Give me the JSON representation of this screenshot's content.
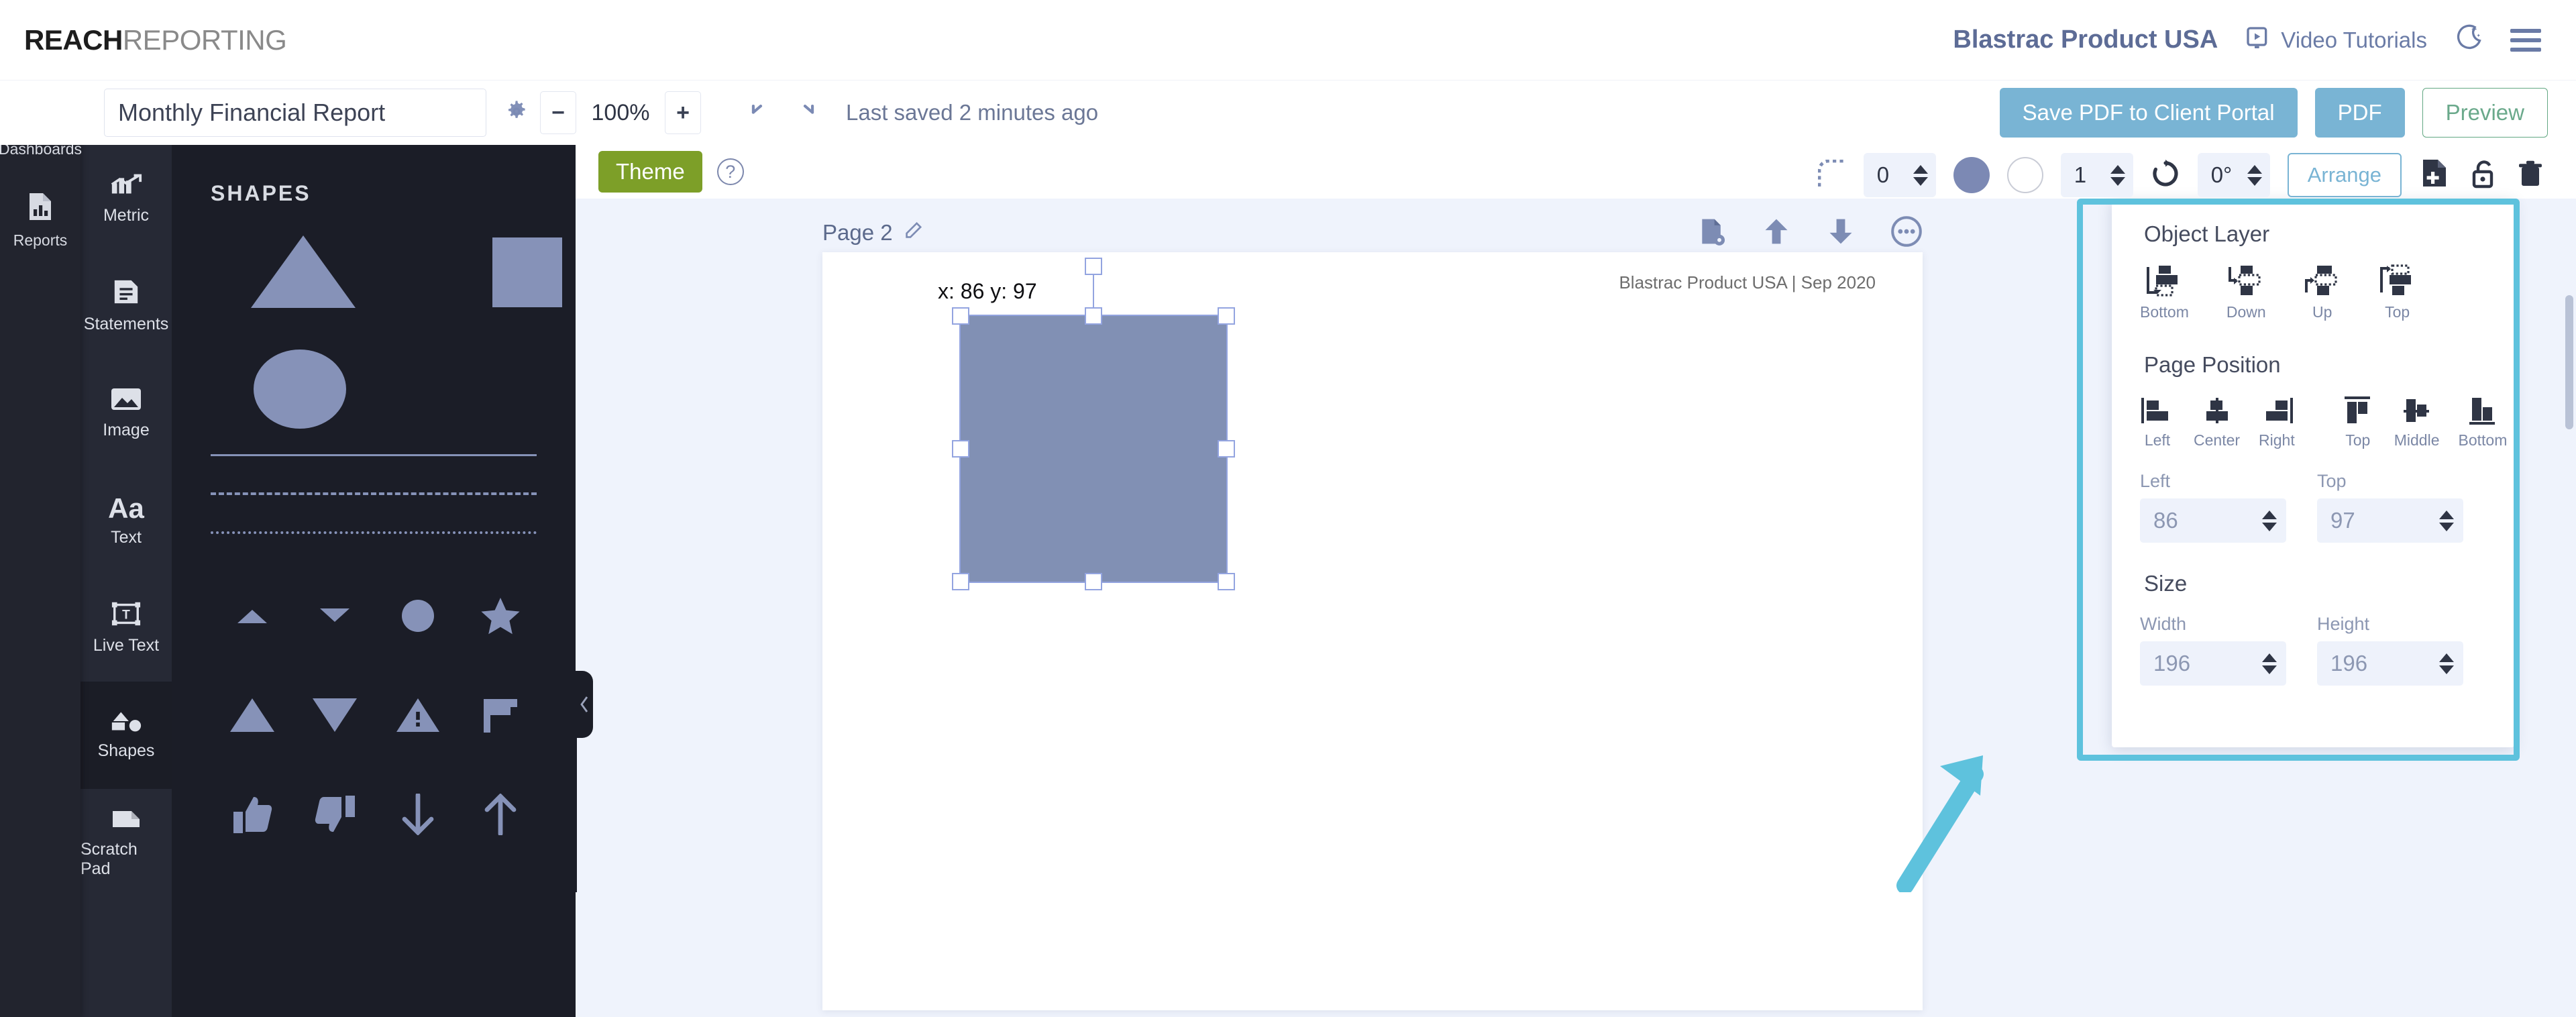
{
  "header": {
    "logo_bold": "REACH",
    "logo_light": "REPORTING",
    "company_name": "Blastrac Product USA",
    "video_tutorials_label": "Video Tutorials",
    "video_tutorials_icon": "video-play-icon",
    "dark_mode_icon": "moon-star-icon",
    "menu_icon": "hamburger-menu-icon",
    "accent_color": "#6a7ba6"
  },
  "toolbar": {
    "report_title": "Monthly Financial Report",
    "report_title_placeholder": "Report name",
    "settings_icon": "gear-icon",
    "zoom_out_label": "−",
    "zoom_level": "100%",
    "zoom_in_label": "+",
    "undo_icon": "undo-arrow-icon",
    "redo_icon": "redo-arrow-icon",
    "save_status": "Last saved 2 minutes ago",
    "save_pdf_label": "Save PDF to Client Portal",
    "pdf_label": "PDF",
    "preview_label": "Preview",
    "primary_color": "#79b4d4",
    "preview_color": "#63a883"
  },
  "rail": {
    "items": [
      {
        "label": "Dashboards",
        "icon": "dashboard-monitor-icon"
      },
      {
        "label": "Reports",
        "icon": "report-chart-file-icon"
      }
    ]
  },
  "tools": {
    "items": [
      {
        "label": "Metric",
        "icon": "metric-bars-icon",
        "active": false
      },
      {
        "label": "Statements",
        "icon": "statement-document-icon",
        "active": false
      },
      {
        "label": "Image",
        "icon": "image-picture-icon",
        "active": false
      },
      {
        "label": "Text",
        "icon": "text-aa-icon",
        "active": false
      },
      {
        "label": "Live Text",
        "icon": "live-text-box-icon",
        "active": false
      },
      {
        "label": "Shapes",
        "icon": "shapes-icon",
        "active": true
      },
      {
        "label": "Scratch Pad",
        "icon": "scratch-pad-icon",
        "active": false
      }
    ]
  },
  "shapes_panel": {
    "title": "SHAPES",
    "shape_color": "#8692b8",
    "primary_shapes": [
      {
        "name": "triangle-large",
        "icon": "triangle-icon"
      },
      {
        "name": "square-large",
        "icon": "square-icon"
      },
      {
        "name": "circle-large",
        "icon": "circle-icon"
      }
    ],
    "lines": [
      {
        "name": "solid-line",
        "style": "solid"
      },
      {
        "name": "dashed-line",
        "style": "dashed"
      },
      {
        "name": "dotted-line",
        "style": "dotted"
      }
    ],
    "icon_shapes": [
      {
        "name": "caret-up",
        "icon": "caret-up-icon"
      },
      {
        "name": "caret-down",
        "icon": "caret-down-icon"
      },
      {
        "name": "circle-small",
        "icon": "circle-filled-icon"
      },
      {
        "name": "star",
        "icon": "star-icon"
      },
      {
        "name": "triangle-up",
        "icon": "triangle-up-icon"
      },
      {
        "name": "triangle-down",
        "icon": "triangle-down-icon"
      },
      {
        "name": "warning-triangle",
        "icon": "warning-triangle-icon"
      },
      {
        "name": "flag",
        "icon": "flag-icon"
      },
      {
        "name": "thumbs-up",
        "icon": "thumbs-up-icon"
      },
      {
        "name": "thumbs-down",
        "icon": "thumbs-down-icon"
      },
      {
        "name": "arrow-down",
        "icon": "arrow-down-icon"
      },
      {
        "name": "arrow-up",
        "icon": "arrow-up-icon"
      }
    ],
    "collapse_icon": "chevron-left-icon"
  },
  "canvas": {
    "theme_label": "Theme",
    "theme_color": "#7d9f28",
    "help_icon": "question-mark-icon",
    "page_label": "Page 2",
    "page_edit_icon": "pencil-edit-icon",
    "page_icons": [
      {
        "name": "page-settings",
        "icon": "file-gear-icon"
      },
      {
        "name": "move-page-up",
        "icon": "arrow-up-icon"
      },
      {
        "name": "move-page-down",
        "icon": "arrow-down-icon"
      },
      {
        "name": "page-more-options",
        "icon": "ellipsis-circle-icon"
      }
    ],
    "page_header_text": "Blastrac Product USA |  Sep 2020",
    "selected_shape": {
      "coord_label": "x: 86 y: 97",
      "fill_color": "#8190b4",
      "selection_color": "#93a4e0"
    }
  },
  "object_toolbar": {
    "border_radius_icon": "corner-radius-icon",
    "border_radius_value": "0",
    "fill_swatch_color": "#7c89b4",
    "stroke_swatch_color": "#ffffff",
    "stroke_width_value": "1",
    "rotate_icon": "rotate-icon",
    "rotation_value": "0°",
    "arrange_label": "Arrange",
    "duplicate_icon": "duplicate-file-icon",
    "lock_icon": "unlock-padlock-icon",
    "delete_icon": "trash-can-icon"
  },
  "arrange_popup": {
    "object_layer": {
      "title": "Object Layer",
      "items": [
        {
          "label": "Bottom",
          "icon": "layer-send-to-back-icon"
        },
        {
          "label": "Down",
          "icon": "layer-send-backward-icon"
        },
        {
          "label": "Up",
          "icon": "layer-bring-forward-icon"
        },
        {
          "label": "Top",
          "icon": "layer-bring-to-front-icon"
        }
      ]
    },
    "page_position": {
      "title": "Page Position",
      "items": [
        {
          "label": "Left",
          "icon": "align-left-icon"
        },
        {
          "label": "Center",
          "icon": "align-center-icon"
        },
        {
          "label": "Right",
          "icon": "align-right-icon"
        },
        {
          "label": "Top",
          "icon": "align-top-icon"
        },
        {
          "label": "Middle",
          "icon": "align-middle-icon"
        },
        {
          "label": "Bottom",
          "icon": "align-bottom-icon"
        }
      ],
      "fields": [
        {
          "label": "Left",
          "value": "86"
        },
        {
          "label": "Top",
          "value": "97"
        }
      ]
    },
    "size": {
      "title": "Size",
      "fields": [
        {
          "label": "Width",
          "value": "196"
        },
        {
          "label": "Height",
          "value": "196"
        }
      ]
    },
    "highlight_color": "#5ec2dd"
  }
}
